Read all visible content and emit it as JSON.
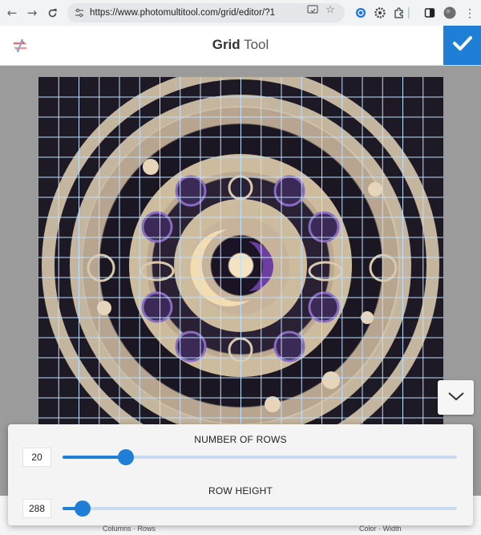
{
  "browser": {
    "url": "https://www.photomultitool.com/grid/editor/?1",
    "nav": {
      "back_icon": "back-arrow-icon",
      "forward_icon": "forward-arrow-icon",
      "reload_icon": "reload-icon"
    }
  },
  "header": {
    "title_bold": "Grid",
    "title_light": "Tool",
    "confirm_icon": "checkmark-icon",
    "accent": "#1f7fd6"
  },
  "canvas": {
    "grid_rows": 20,
    "grid_columns": 20,
    "grid_line_color": "#bfe0ff"
  },
  "settings": {
    "rows_label": "NUMBER OF ROWS",
    "rows_value": "20",
    "rows_level": 0.16,
    "height_label": "ROW HEIGHT",
    "height_value": "288",
    "height_level": 0.05
  },
  "toolbar": {
    "left_label": "Columns · Rows",
    "right_label": "Color · Width"
  }
}
